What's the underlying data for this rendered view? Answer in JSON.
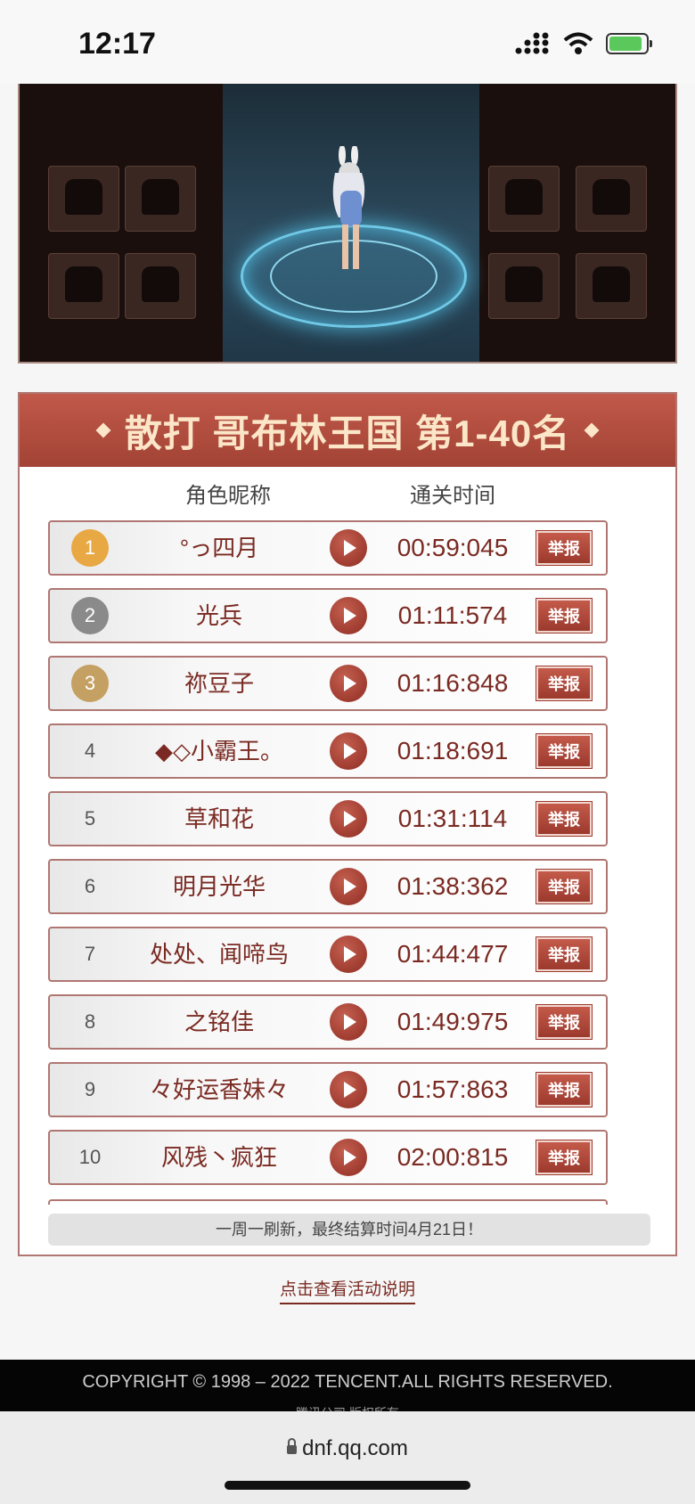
{
  "status_bar": {
    "time": "12:17"
  },
  "ranking": {
    "title": "散打 哥布林王国 第1-40名",
    "col_name": "角色昵称",
    "col_time": "通关时间",
    "report_label": "举报",
    "rows": [
      {
        "rank": "1",
        "name": "°っ四月",
        "time": "00:59:045"
      },
      {
        "rank": "2",
        "name": "光兵",
        "time": "01:11:574"
      },
      {
        "rank": "3",
        "name": "祢豆子",
        "time": "01:16:848"
      },
      {
        "rank": "4",
        "name": "◆◇小霸王。",
        "time": "01:18:691"
      },
      {
        "rank": "5",
        "name": "草和花",
        "time": "01:31:114"
      },
      {
        "rank": "6",
        "name": "明月光华",
        "time": "01:38:362"
      },
      {
        "rank": "7",
        "name": "处处、闻啼鸟",
        "time": "01:44:477"
      },
      {
        "rank": "8",
        "name": "之铭佳",
        "time": "01:49:975"
      },
      {
        "rank": "9",
        "name": "々好运香妹々",
        "time": "01:57:863"
      },
      {
        "rank": "10",
        "name": "风残丶疯狂",
        "time": "02:00:815"
      }
    ],
    "notice": "一周一刷新，最终结算时间4月21日！"
  },
  "explain_link": "点击查看活动说明",
  "footer": {
    "copyright": "COPYRIGHT © 1998 – 2022 TENCENT.ALL RIGHTS RESERVED.",
    "sub": "腾讯公司 版权所有"
  },
  "browser": {
    "url": "dnf.qq.com"
  },
  "colors": {
    "accent": "#a24335",
    "text_dark_red": "#7a2a22",
    "gold": "#e8a843",
    "silver": "#8a8a8a",
    "bronze": "#c4a062"
  }
}
